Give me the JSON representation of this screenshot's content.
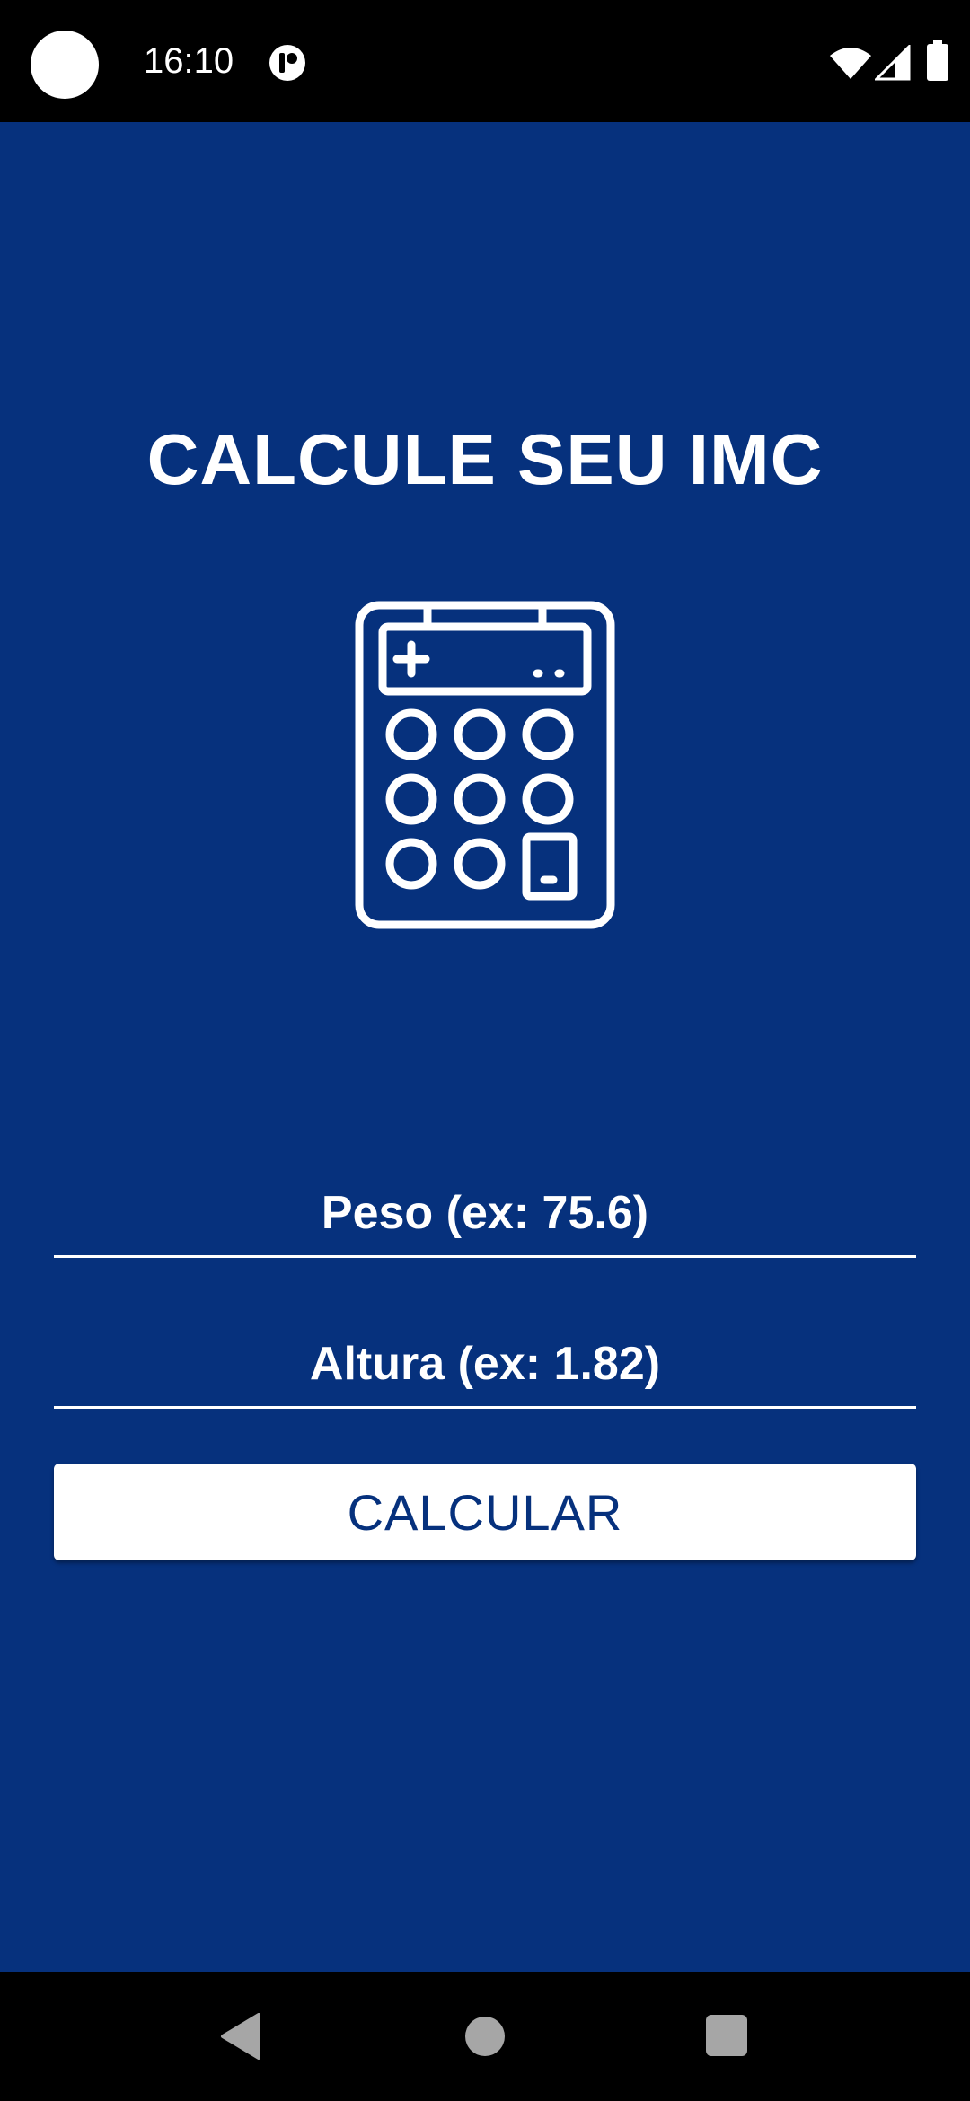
{
  "status_bar": {
    "time": "16:10",
    "icons": [
      "camera-cutout",
      "notification-icon",
      "wifi-icon",
      "signal-icon",
      "battery-icon"
    ]
  },
  "app": {
    "background_color": "#06317d",
    "title": "CALCULE SEU IMC",
    "hero_icon": "calculator-icon",
    "fields": {
      "peso": {
        "value": "",
        "placeholder": "Peso (ex: 75.6)"
      },
      "altura": {
        "value": "",
        "placeholder": "Altura (ex: 1.82)"
      }
    },
    "button": {
      "label": "CALCULAR",
      "background": "#ffffff",
      "text_color": "#06317d"
    }
  },
  "nav_bar": {
    "buttons": [
      "back-icon",
      "home-icon",
      "recents-icon"
    ]
  }
}
